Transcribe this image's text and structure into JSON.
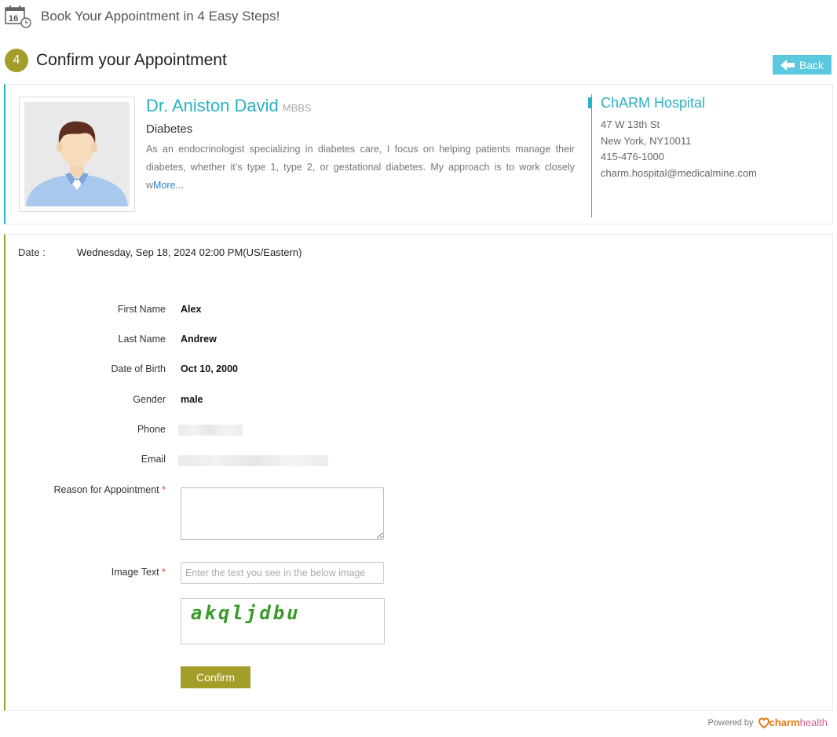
{
  "header": {
    "title": "Book Your Appointment in 4 Easy Steps!",
    "calendar_day": "16"
  },
  "step": {
    "number": "4",
    "title": "Confirm your Appointment"
  },
  "back_button": {
    "label": "Back"
  },
  "doctor": {
    "name": "Dr. Aniston David",
    "degree": "MBBS",
    "specialty": "Diabetes",
    "bio": "As an endocrinologist specializing in diabetes care, I focus on helping patients manage their diabetes, whether it’s type 1, type 2, or gestational diabetes. My approach is to work closely w",
    "more_link": "More..."
  },
  "hospital": {
    "name": "ChARM Hospital",
    "address_line1": "47 W 13th St",
    "address_line2": "New York, NY10011",
    "phone": "415-476-1000",
    "email": "charm.hospital@medicalmine.com"
  },
  "appointment": {
    "date_label": "Date :",
    "date_value": "Wednesday, Sep 18, 2024 02:00 PM(US/Eastern)"
  },
  "patient": {
    "first_name_label": "First Name",
    "first_name": "Alex",
    "last_name_label": "Last Name",
    "last_name": "Andrew",
    "dob_label": "Date of Birth",
    "dob": "Oct 10, 2000",
    "gender_label": "Gender",
    "gender": "male",
    "phone_label": "Phone",
    "email_label": "Email"
  },
  "form": {
    "reason_label": "Reason for Appointment",
    "required_mark": "*",
    "reason_value": "",
    "image_text_label": "Image Text",
    "image_text_placeholder": "Enter the text you see in the below image",
    "captcha_text": "akqljdbu",
    "confirm_label": "Confirm"
  },
  "footer": {
    "powered_by": "Powered by",
    "brand_part1": "charm",
    "brand_part2": "health"
  },
  "colors": {
    "accent_teal": "#2ab1c3",
    "accent_olive": "#a39e2a",
    "back_button": "#5bc8e0",
    "captcha_green": "#3a9a2a"
  }
}
